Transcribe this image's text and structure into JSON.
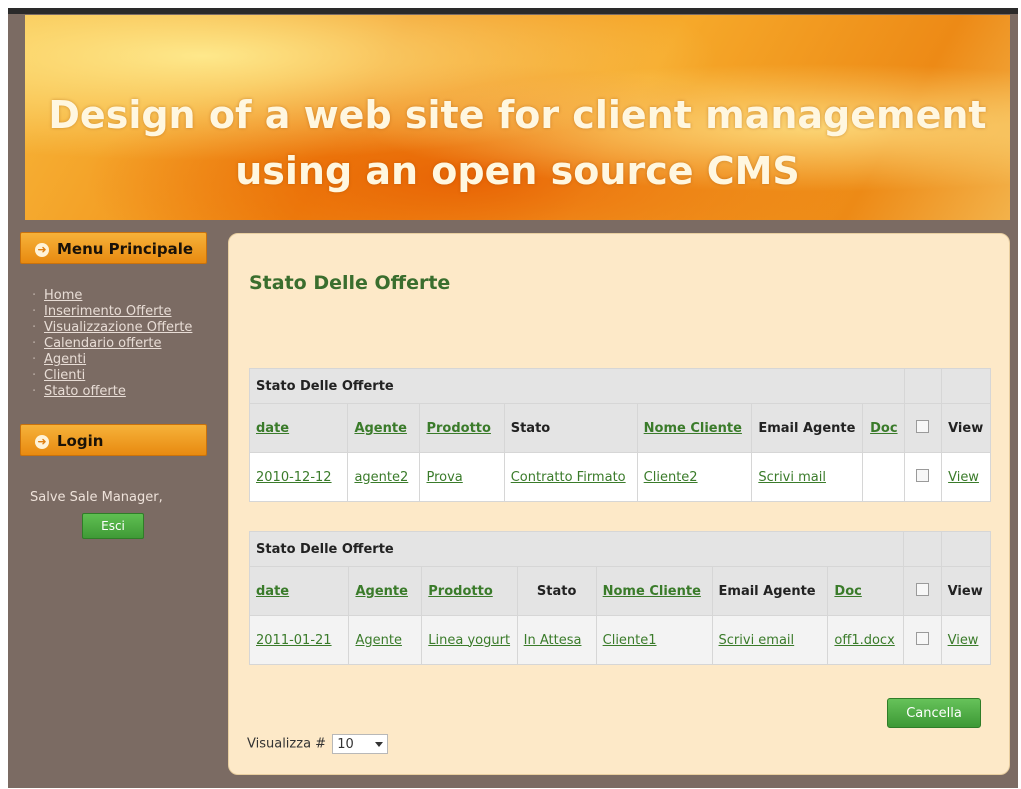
{
  "banner": {
    "line1": "Design of a web site for client management",
    "line2": "using an open source CMS"
  },
  "sidebar": {
    "menu_header": "Menu Principale",
    "items": [
      "Home",
      "Inserimento Offerte",
      "Visualizzazione Offerte",
      "Calendario offerte",
      "Agenti",
      "Clienti",
      "Stato offerte"
    ],
    "login_header": "Login",
    "greeting": "Salve Sale Manager,",
    "logout_button": "Esci"
  },
  "main": {
    "title": "Stato Delle Offerte",
    "tables": [
      {
        "caption": "Stato Delle Offerte",
        "headers": [
          "date",
          "Agente",
          "Prodotto",
          "Stato",
          "Nome Cliente",
          "Email Agente",
          "Doc",
          "",
          "View"
        ],
        "row": {
          "date": "2010-12-12",
          "agente": "agente2",
          "prodotto": "Prova",
          "stato": "Contratto Firmato",
          "cliente": "Cliente2",
          "email": "Scrivi mail",
          "doc": "",
          "view": "View"
        }
      },
      {
        "caption": "Stato Delle Offerte",
        "headers": [
          "date",
          "Agente",
          "Prodotto",
          "Stato",
          "Nome Cliente",
          "Email Agente",
          "Doc",
          "",
          "View"
        ],
        "row": {
          "date": "2011-01-21",
          "agente": "Agente",
          "prodotto": "Linea yogurt",
          "stato": "In Attesa",
          "cliente": "Cliente1",
          "email": "Scrivi email",
          "doc": "off1.docx",
          "view": "View"
        }
      }
    ],
    "cancel_button": "Cancella",
    "show_label": "Visualizza #",
    "show_value": "10"
  },
  "colors": {
    "banner_orange": "#f08a12",
    "sidebar_bg": "#7b6b63",
    "content_bg": "#fde9c8",
    "link_green": "#3a7b2a",
    "button_green": "#4fae43"
  }
}
